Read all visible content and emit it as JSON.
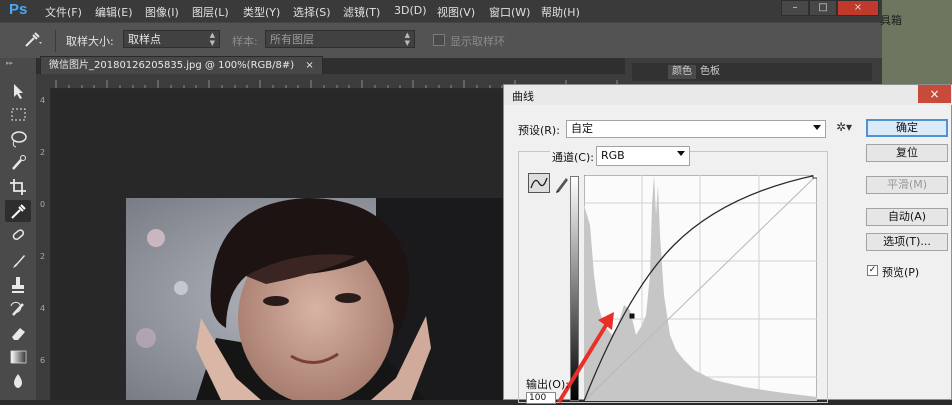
{
  "app": {
    "logo": "Ps"
  },
  "menu": [
    "文件(F)",
    "编辑(E)",
    "图像(I)",
    "图层(L)",
    "类型(Y)",
    "选择(S)",
    "滤镜(T)",
    "3D(D)",
    "视图(V)",
    "窗口(W)",
    "帮助(H)"
  ],
  "window_controls": {
    "minimize": "–",
    "maximize": "□",
    "close": "×"
  },
  "options": {
    "sample_size_label": "取样大小:",
    "sample_size_value": "取样点",
    "sample_label": "样本:",
    "sample_value": "所有图层",
    "show_ring_label": "显示取样环"
  },
  "document_tab": {
    "title": "微信图片_20180126205835.jpg @ 100%(RGB/8#)",
    "close": "×"
  },
  "ruler": {
    "vertical_labels": [
      "4",
      "2",
      "0",
      "2",
      "4",
      "6"
    ]
  },
  "panels": {
    "tabs": [
      "颜色",
      "色板"
    ],
    "side_text": "具箱"
  },
  "curves": {
    "title": "曲线",
    "close": "×",
    "preset_label": "预设(R):",
    "preset_value": "自定",
    "channel_label": "通道(C):",
    "channel_value": "RGB",
    "output_label": "输出(O):",
    "output_value": "100",
    "buttons": {
      "ok": "确定",
      "reset": "复位",
      "smooth": "平滑(M)",
      "auto": "自动(A)",
      "options": "选项(T)..."
    },
    "preview_label": "预览(P)",
    "preview_checked": "✓",
    "colors": {
      "arrow": "#e8302a",
      "ok_border": "#4f93d2",
      "close_bg": "#c84a3a"
    }
  }
}
